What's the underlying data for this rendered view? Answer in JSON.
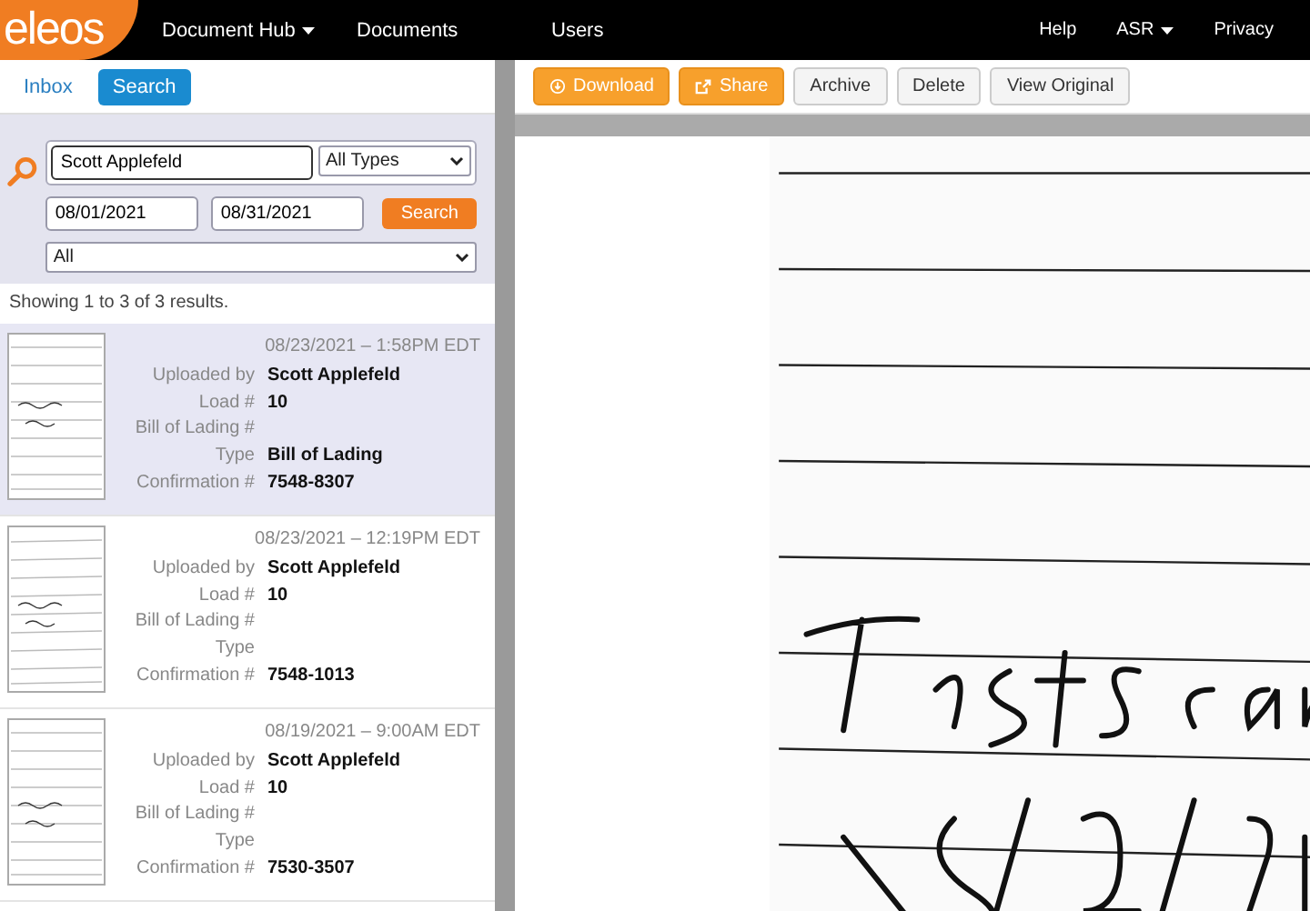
{
  "nav": {
    "logo": "eleos",
    "items": [
      {
        "label": "Document Hub",
        "dropdown": true
      },
      {
        "label": "Documents",
        "dropdown": false
      },
      {
        "label": "Users",
        "dropdown": false
      }
    ],
    "right_items": [
      {
        "label": "Help",
        "dropdown": false
      },
      {
        "label": "ASR",
        "dropdown": true
      },
      {
        "label": "Privacy",
        "dropdown": false
      }
    ]
  },
  "tabs": [
    {
      "label": "Inbox",
      "selected": false
    },
    {
      "label": "Search",
      "selected": true
    }
  ],
  "search": {
    "name": "Scott Applefeld",
    "type": "All Types",
    "date_from": "08/01/2021",
    "date_to": "08/31/2021",
    "button": "Search",
    "status": "All"
  },
  "results_summary": "Showing 1 to 3 of 3 results.",
  "results": [
    {
      "timestamp": "08/23/2021 – 1:58PM EDT",
      "selected": true,
      "fields": [
        {
          "label": "Uploaded by",
          "value": "Scott Applefeld"
        },
        {
          "label": "Load #",
          "value": "10"
        },
        {
          "label": "Bill of Lading #"
        },
        {
          "label": "Type",
          "value": "Bill of Lading"
        },
        {
          "label": "Confirmation #",
          "value": "7548-8307"
        }
      ]
    },
    {
      "timestamp": "08/23/2021 – 12:19PM EDT",
      "selected": false,
      "fields": [
        {
          "label": "Uploaded by",
          "value": "Scott Applefeld"
        },
        {
          "label": "Load #",
          "value": "10"
        },
        {
          "label": "Bill of Lading #"
        },
        {
          "label": "Type"
        },
        {
          "label": "Confirmation #",
          "value": "7548-1013"
        }
      ]
    },
    {
      "timestamp": "08/19/2021 – 9:00AM EDT",
      "selected": false,
      "fields": [
        {
          "label": "Uploaded by",
          "value": "Scott Applefeld"
        },
        {
          "label": "Load #",
          "value": "10"
        },
        {
          "label": "Bill of Lading #"
        },
        {
          "label": "Type"
        },
        {
          "label": "Confirmation #",
          "value": "7530-3507"
        }
      ]
    }
  ],
  "toolbar": [
    {
      "label": "Download",
      "kind": "download"
    },
    {
      "label": "Share",
      "kind": "share"
    },
    {
      "label": "Archive",
      "kind": "plain"
    },
    {
      "label": "Delete",
      "kind": "plain"
    },
    {
      "label": "View Original",
      "kind": "plain"
    }
  ]
}
